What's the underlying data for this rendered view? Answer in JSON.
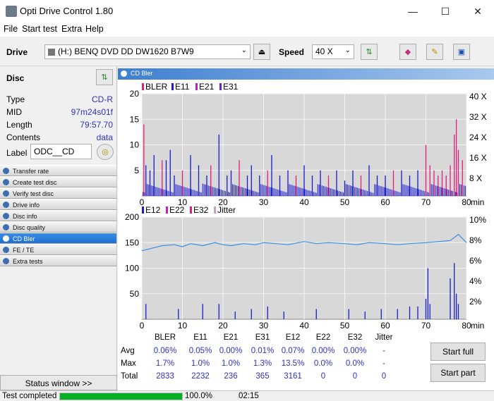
{
  "window": {
    "title": "Opti Drive Control 1.80",
    "minimize": "—",
    "maximize": "☐",
    "close": "✕"
  },
  "menu": [
    "File",
    "Start test",
    "Extra",
    "Help"
  ],
  "toolbar": {
    "drive_label": "Drive",
    "drive_value": "(H:)  BENQ DVD DD DW1620 B7W9",
    "speed_label": "Speed",
    "speed_value": "40 X"
  },
  "disc": {
    "header": "Disc",
    "rows": [
      {
        "k": "Type",
        "v": "CD-R"
      },
      {
        "k": "MID",
        "v": "97m24s01f"
      },
      {
        "k": "Length",
        "v": "79:57.70"
      },
      {
        "k": "Contents",
        "v": "data"
      }
    ],
    "label_key": "Label",
    "label_value": "ODC__CD"
  },
  "nav": [
    "Transfer rate",
    "Create test disc",
    "Verify test disc",
    "Drive info",
    "Disc info",
    "Disc quality",
    "CD Bler",
    "FE / TE",
    "Extra tests"
  ],
  "nav_active": 6,
  "status_window": "Status window >>",
  "panel_title": "CD Bler",
  "stats": {
    "headers": [
      "BLER",
      "E11",
      "E21",
      "E31",
      "E12",
      "E22",
      "E32",
      "Jitter"
    ],
    "rows": [
      {
        "label": "Avg",
        "values": [
          "0.06%",
          "0.05%",
          "0.00%",
          "0.01%",
          "0.07%",
          "0.00%",
          "0.00%",
          "-"
        ]
      },
      {
        "label": "Max",
        "values": [
          "1.7%",
          "1.0%",
          "1.0%",
          "1.3%",
          "13.5%",
          "0.0%",
          "0.0%",
          "-"
        ]
      },
      {
        "label": "Total",
        "values": [
          "2833",
          "2232",
          "236",
          "365",
          "3161",
          "0",
          "0",
          "0"
        ]
      }
    ]
  },
  "buttons": {
    "start_full": "Start full",
    "start_part": "Start part"
  },
  "status": {
    "text": "Test completed",
    "progress": 1.0,
    "percent": "100.0%",
    "time": "02:15"
  },
  "chart_data": [
    {
      "type": "bar",
      "legend": [
        "BLER",
        "E11",
        "E21",
        "E31"
      ],
      "legend_colors": [
        "#e0207a",
        "#1a1ad0",
        "#c020c0",
        "#7a20c0"
      ],
      "x_ticks": [
        "0",
        "10",
        "20",
        "30",
        "40",
        "50",
        "60",
        "70",
        "80"
      ],
      "x_unit": "min",
      "xlim": [
        0,
        80
      ],
      "y_ticks": [
        "5",
        "10",
        "15",
        "20"
      ],
      "ylim": [
        0,
        20
      ],
      "y2_ticks": [
        "8 X",
        "16 X",
        "24 X",
        "32 X",
        "40 X"
      ],
      "spikes": [
        [
          0.5,
          14
        ],
        [
          1,
          6
        ],
        [
          2,
          5
        ],
        [
          3,
          8
        ],
        [
          5,
          7
        ],
        [
          6,
          7
        ],
        [
          7,
          9
        ],
        [
          8,
          4
        ],
        [
          10,
          5
        ],
        [
          12,
          8
        ],
        [
          14,
          6
        ],
        [
          16,
          4
        ],
        [
          17,
          6
        ],
        [
          19,
          12
        ],
        [
          21,
          4
        ],
        [
          22,
          5
        ],
        [
          24,
          7
        ],
        [
          26,
          4
        ],
        [
          27,
          6
        ],
        [
          29,
          4
        ],
        [
          31,
          5
        ],
        [
          32,
          8
        ],
        [
          34,
          4
        ],
        [
          36,
          5
        ],
        [
          38,
          4
        ],
        [
          40,
          6
        ],
        [
          42,
          4
        ],
        [
          44,
          5
        ],
        [
          46,
          4
        ],
        [
          48,
          5
        ],
        [
          50,
          3
        ],
        [
          52,
          5
        ],
        [
          54,
          4
        ],
        [
          56,
          6
        ],
        [
          58,
          4
        ],
        [
          60,
          4
        ],
        [
          62,
          5
        ],
        [
          64,
          5
        ],
        [
          66,
          4
        ],
        [
          68,
          5
        ],
        [
          70,
          10
        ],
        [
          71,
          6
        ],
        [
          72,
          5
        ],
        [
          73,
          4
        ],
        [
          74,
          5
        ],
        [
          75,
          4
        ],
        [
          76,
          6
        ],
        [
          77,
          12
        ],
        [
          77.5,
          15
        ],
        [
          78,
          9
        ],
        [
          79,
          7
        ]
      ]
    },
    {
      "type": "bar",
      "legend": [
        "E12",
        "E22",
        "E32",
        "Jitter"
      ],
      "legend_colors": [
        "#1a1ad0",
        "#c020c0",
        "#e0207a",
        "#c0a0c0"
      ],
      "x_ticks": [
        "0",
        "10",
        "20",
        "30",
        "40",
        "50",
        "60",
        "70",
        "80"
      ],
      "x_unit": "min",
      "xlim": [
        0,
        80
      ],
      "y_ticks": [
        "50",
        "100",
        "150",
        "200"
      ],
      "ylim": [
        0,
        200
      ],
      "y2_ticks": [
        "2%",
        "4%",
        "6%",
        "8%",
        "10%"
      ],
      "jitter": [
        [
          0,
          6.7
        ],
        [
          2,
          6.9
        ],
        [
          5,
          7.2
        ],
        [
          8,
          7.3
        ],
        [
          10,
          7.1
        ],
        [
          12,
          7.4
        ],
        [
          15,
          7.2
        ],
        [
          18,
          7.5
        ],
        [
          20,
          7.3
        ],
        [
          22,
          7.2
        ],
        [
          25,
          7.4
        ],
        [
          28,
          7.3
        ],
        [
          30,
          7.5
        ],
        [
          33,
          7.4
        ],
        [
          36,
          7.3
        ],
        [
          40,
          7.6
        ],
        [
          43,
          7.4
        ],
        [
          46,
          7.5
        ],
        [
          50,
          7.4
        ],
        [
          53,
          7.3
        ],
        [
          56,
          7.5
        ],
        [
          60,
          7.4
        ],
        [
          63,
          7.3
        ],
        [
          66,
          7.4
        ],
        [
          70,
          7.5
        ],
        [
          73,
          7.6
        ],
        [
          76,
          7.7
        ],
        [
          78,
          8.3
        ],
        [
          80,
          7.5
        ]
      ],
      "spikes": [
        [
          1,
          30
        ],
        [
          9,
          20
        ],
        [
          15,
          30
        ],
        [
          19,
          30
        ],
        [
          23,
          15
        ],
        [
          27,
          20
        ],
        [
          31,
          25
        ],
        [
          35,
          15
        ],
        [
          43,
          20
        ],
        [
          51,
          20
        ],
        [
          55,
          15
        ],
        [
          59,
          20
        ],
        [
          63,
          20
        ],
        [
          66,
          25
        ],
        [
          68,
          25
        ],
        [
          70,
          40
        ],
        [
          70.5,
          100
        ],
        [
          71,
          30
        ],
        [
          76,
          80
        ],
        [
          77,
          110
        ],
        [
          77.5,
          50
        ],
        [
          78,
          30
        ]
      ]
    }
  ]
}
